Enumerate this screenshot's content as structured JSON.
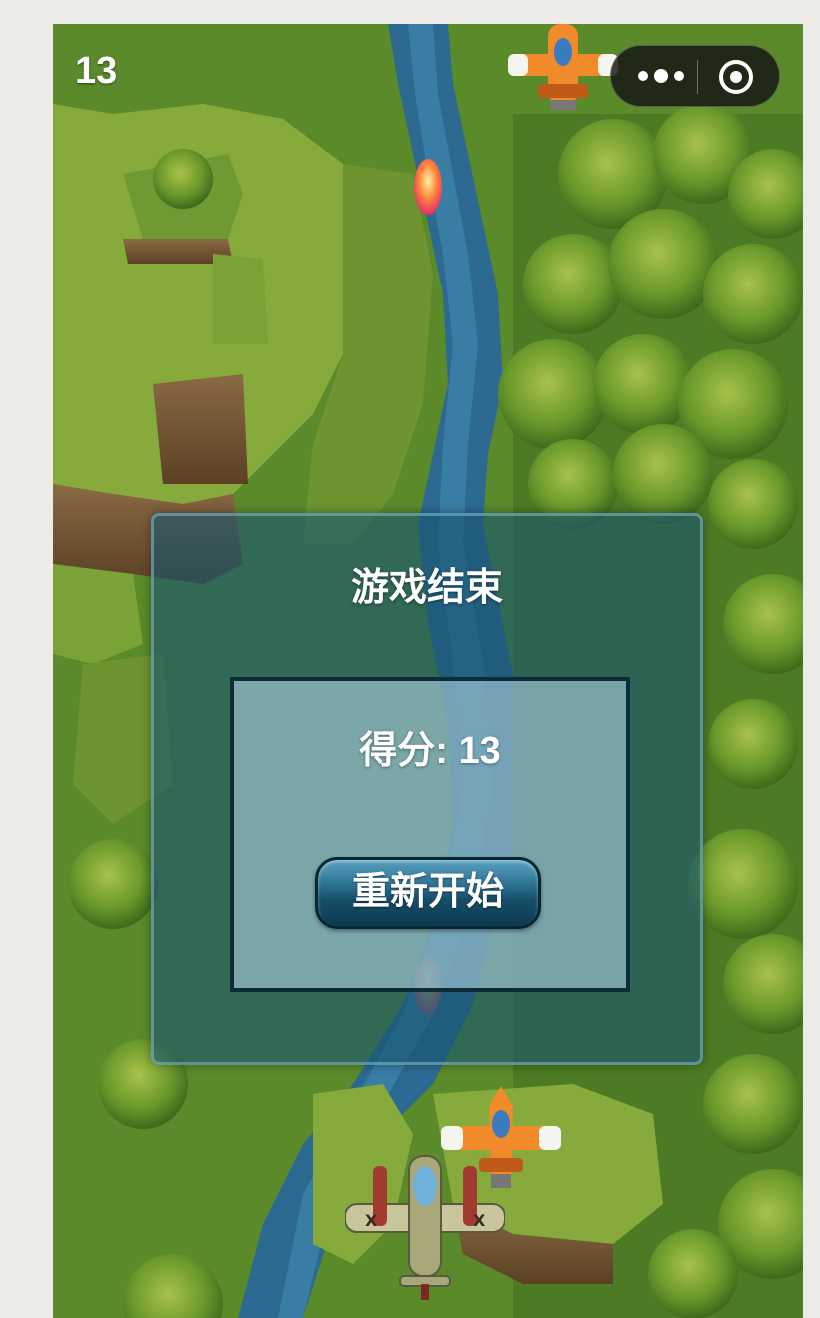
{
  "hud": {
    "score": "13"
  },
  "menu_capsule": {
    "more_icon": "more-dots-icon",
    "close_icon": "target-circle-icon"
  },
  "game_over": {
    "title": "游戏结束",
    "score_label": "得分:",
    "score_value": "13",
    "restart_label": "重新开始"
  },
  "colors": {
    "panel": "#195570",
    "button": "#2b6f8f",
    "grass": "#5e8a2c",
    "river": "#2d6a92",
    "enemy_plane": "#f08a2a"
  }
}
